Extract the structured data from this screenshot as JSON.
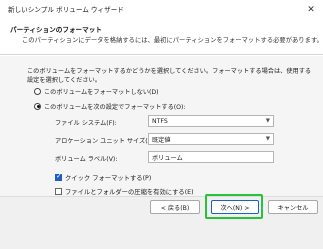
{
  "window": {
    "title": "新しいシンプル ボリューム ウィザード"
  },
  "header": {
    "title": "パーティションのフォーマット",
    "subtitle": "このパーティションにデータを格納するには、最初にパーティションをフォーマットする必要があります。"
  },
  "body": {
    "intro": "このボリュームをフォーマットするかどうかを選択してください。フォーマットする場合は、使用する設定を選択してください。",
    "radio_no_format": "このボリュームをフォーマットしない(D)",
    "radio_format": "このボリュームを次の設定でフォーマットする(O):",
    "file_system_label": "ファイル システム(F):",
    "file_system_value": "NTFS",
    "allocation_label": "アロケーション ユニット サイズ(A):",
    "allocation_value": "既定値",
    "volume_label_label": "ボリューム ラベル(V):",
    "volume_label_value": "ボリューム",
    "quick_format": "クイック フォーマットする(P)",
    "compression": "ファイルとフォルダーの圧縮を有効にする(E)"
  },
  "buttons": {
    "back": "< 戻る(B)",
    "next": "次へ(N) >",
    "cancel": "キャンセル"
  },
  "colors": {
    "accent": "#1d5fc4",
    "highlight": "#27c43a"
  }
}
